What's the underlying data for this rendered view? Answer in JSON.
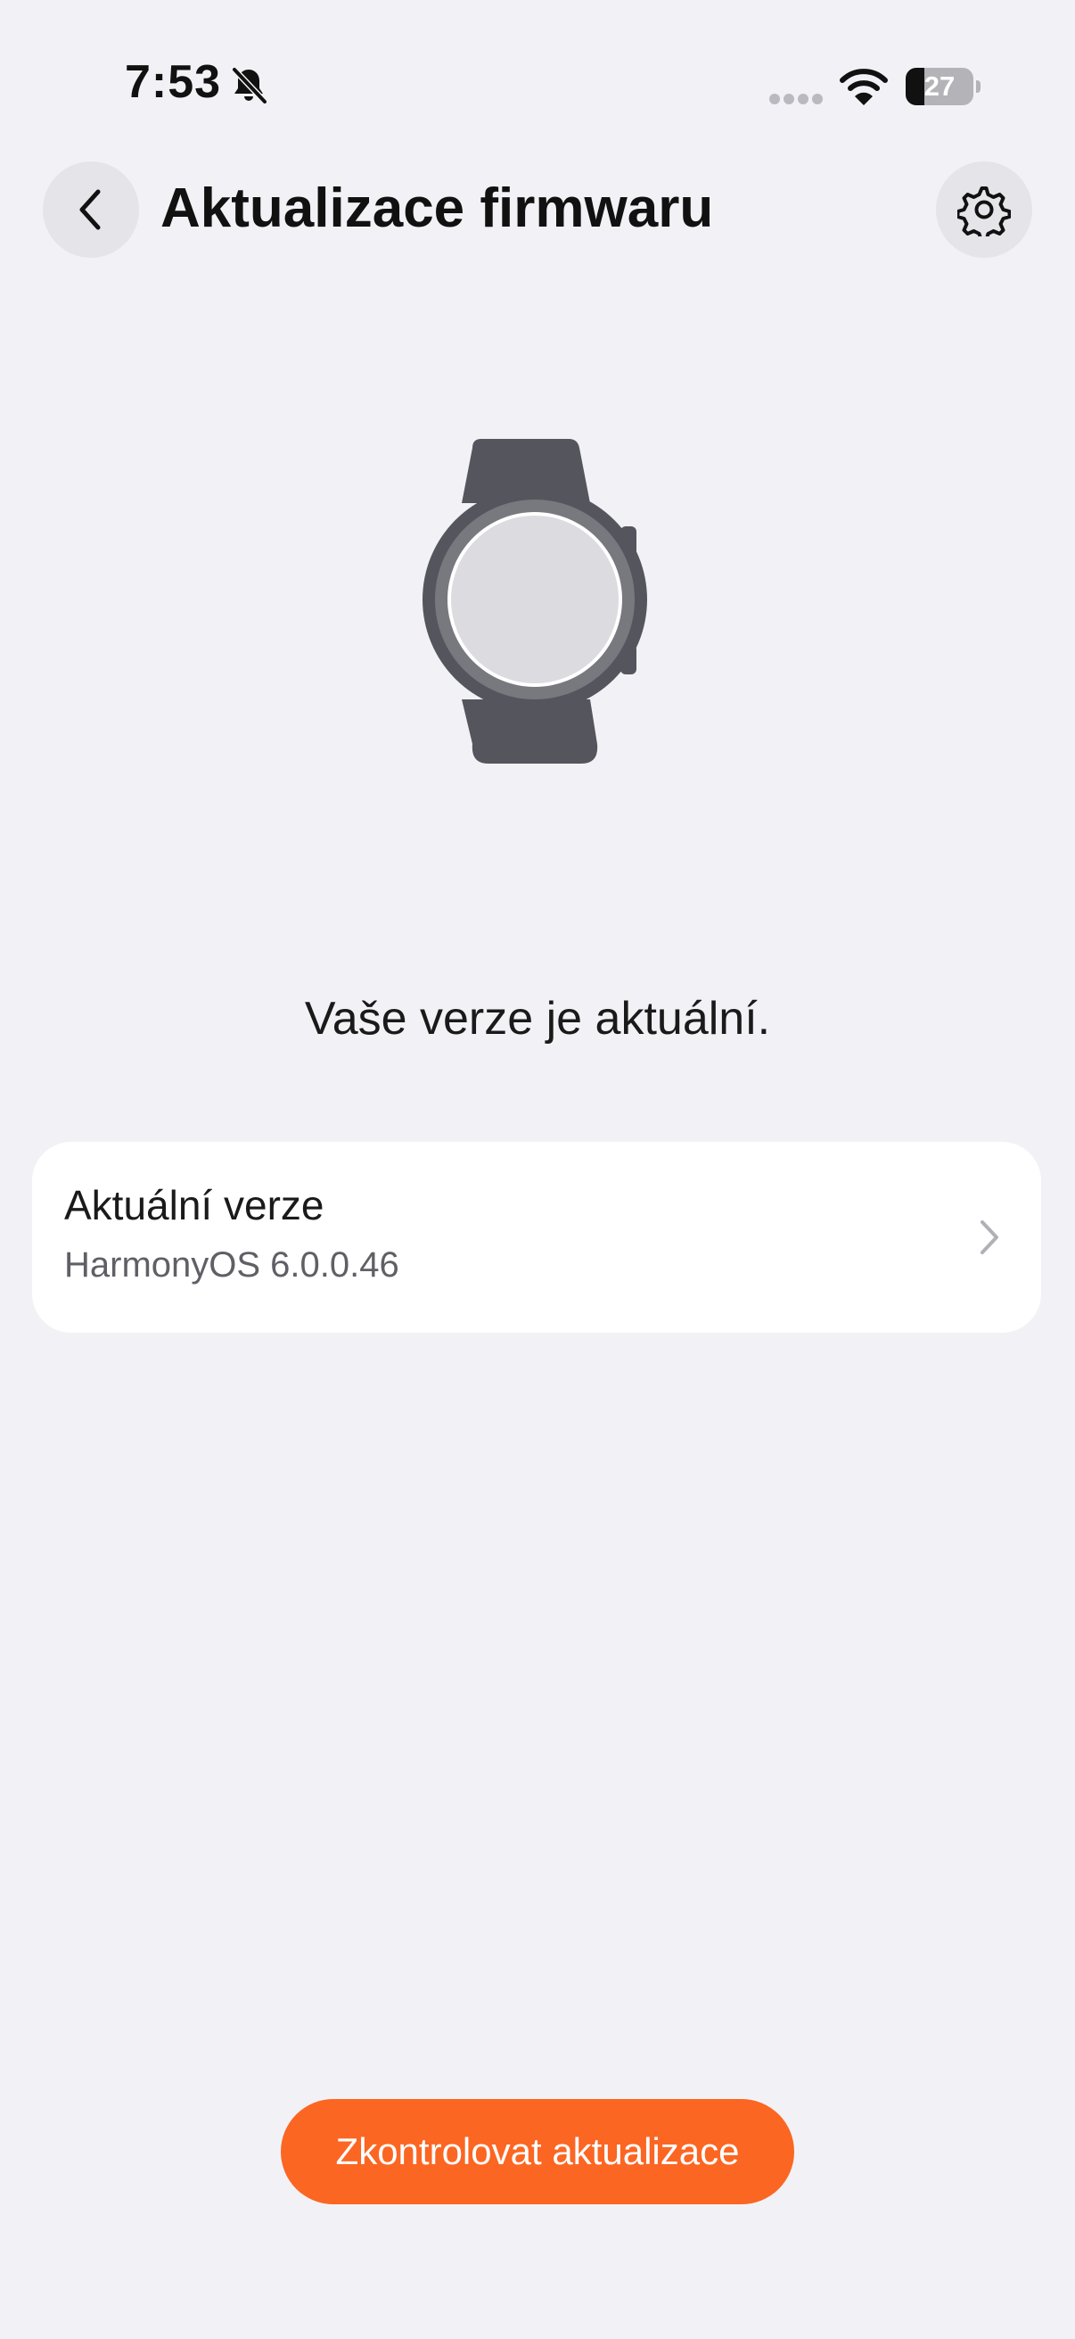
{
  "status_bar": {
    "time": "7:53",
    "battery_level": "27",
    "battery_fraction": 0.27,
    "icons": [
      "bell-muted-icon",
      "signal-dots-icon",
      "wifi-icon",
      "battery-icon"
    ]
  },
  "header": {
    "title": "Aktualizace firmwaru",
    "back_icon": "chevron-left-icon",
    "settings_icon": "gear-icon"
  },
  "illustration": {
    "icon": "smartwatch-icon"
  },
  "status_message": "Vaše verze je aktuální.",
  "version_card": {
    "label": "Aktuální verze",
    "value": "HarmonyOS 6.0.0.46",
    "icon": "chevron-right-icon"
  },
  "actions": {
    "check_updates_label": "Zkontrolovat aktualizace"
  },
  "colors": {
    "background": "#f2f2f6",
    "accent": "#fb6623",
    "card": "#ffffff",
    "watch_body": "#55565d",
    "watch_bezel": "#78787f",
    "watch_face": "#dcdce0"
  }
}
